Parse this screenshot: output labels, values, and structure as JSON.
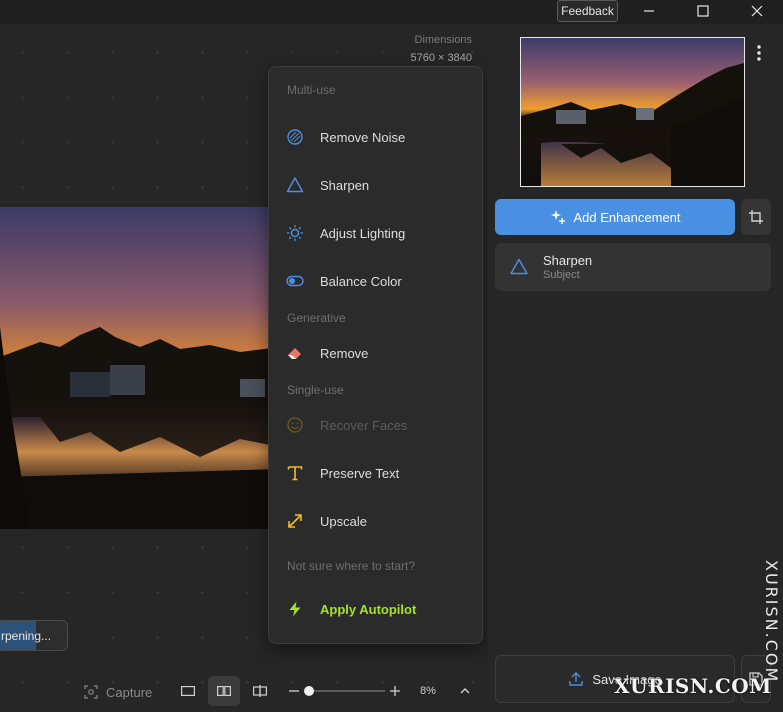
{
  "titlebar": {
    "feedback_label": "Feedback"
  },
  "canvas": {
    "dimensions_label": "Dimensions",
    "dimensions_value": "5760 × 3840",
    "progress_text": "rpening...",
    "progress_fraction": 0.55
  },
  "toolbar": {
    "capture_label": "Capture",
    "zoom_value": "8%",
    "zoom_fraction": 0.05
  },
  "menu": {
    "section_multi": "Multi-use",
    "remove_noise": "Remove Noise",
    "sharpen": "Sharpen",
    "adjust_lighting": "Adjust Lighting",
    "balance_color": "Balance Color",
    "section_generative": "Generative",
    "remove": "Remove",
    "section_single": "Single-use",
    "recover_faces": "Recover Faces",
    "preserve_text": "Preserve Text",
    "upscale": "Upscale",
    "section_start": "Not sure where to start?",
    "apply_autopilot": "Apply Autopilot"
  },
  "right_panel": {
    "add_enhancement_label": "Add Enhancement",
    "enhancement_card": {
      "title": "Sharpen",
      "subtitle": "Subject"
    },
    "save_label": "Save Image"
  },
  "watermark": {
    "vertical": "XURISN.COM",
    "horizontal": "XURISN.COM"
  },
  "colors": {
    "accent": "#4a90e2",
    "autopilot": "#a6e22e",
    "background": "#262626",
    "menu_bg": "#2b2b2b"
  },
  "icons": {
    "remove_noise": "noise-icon",
    "sharpen": "triangle-icon",
    "adjust_lighting": "sun-icon",
    "balance_color": "toggle-icon",
    "remove": "eraser-icon",
    "recover_faces": "face-icon",
    "preserve_text": "text-icon",
    "upscale": "expand-arrow-icon",
    "apply_autopilot": "lightning-icon"
  }
}
